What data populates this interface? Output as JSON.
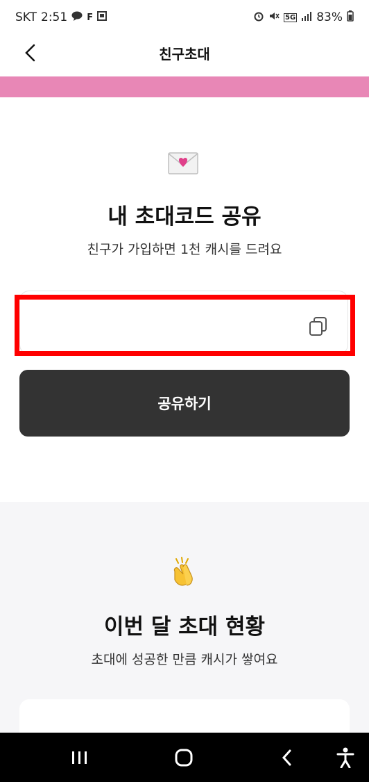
{
  "status_bar": {
    "carrier": "SKT",
    "time": "2:51",
    "notif_icons": [
      "chat-icon",
      "f-app-icon",
      "gallery-icon"
    ],
    "system_icons": [
      "alarm-icon",
      "mute-icon",
      "network-icon",
      "signal-icon"
    ],
    "network": "5G",
    "battery": "83%"
  },
  "header": {
    "title": "친구초대"
  },
  "invite": {
    "emoji": "envelope-heart",
    "title": "내 초대코드 공유",
    "subtitle": "친구가 가입하면 1천 캐시를 드려요",
    "code_value": "",
    "share_label": "공유하기"
  },
  "status_section": {
    "emoji": "clapping-hands",
    "title": "이번 달 초대 현황",
    "subtitle": "초대에 성공한 만큼 캐시가 쌓여요"
  },
  "colors": {
    "pink_band": "#e887b6",
    "button_bg": "#333333",
    "highlight": "#ff0000",
    "section_bg": "#f6f6f8"
  },
  "nav": {
    "icons": [
      "recent-apps-icon",
      "home-icon",
      "back-icon",
      "accessibility-icon"
    ]
  }
}
